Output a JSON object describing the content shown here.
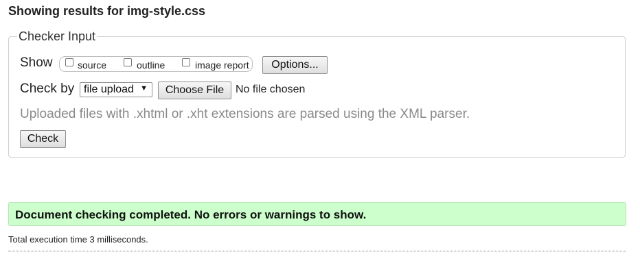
{
  "page": {
    "heading": "Showing results for img-style.css"
  },
  "checker_input": {
    "legend": "Checker Input",
    "show_label": "Show",
    "show_options": [
      {
        "label": "source",
        "checked": false
      },
      {
        "label": "outline",
        "checked": false
      },
      {
        "label": "image report",
        "checked": false
      }
    ],
    "options_button": "Options...",
    "check_by_label": "Check by",
    "check_by_selected": "file upload",
    "choose_file_button": "Choose File",
    "file_status": "No file chosen",
    "help_text": "Uploaded files with .xhtml or .xht extensions are parsed using the XML parser.",
    "check_button": "Check"
  },
  "result": {
    "message": "Document checking completed. No errors or warnings to show.",
    "message_bg": "#ccffcc",
    "execution_time": "Total execution time 3 milliseconds."
  }
}
